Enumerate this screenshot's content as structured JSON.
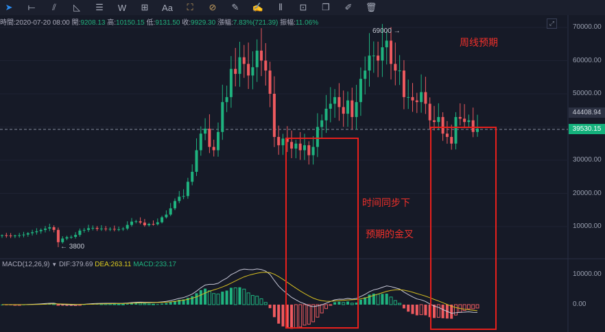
{
  "toolbar": {
    "tools": [
      {
        "name": "cursor-tool",
        "glyph": "➤",
        "cls": "sel"
      },
      {
        "name": "horizontal-line-tool",
        "glyph": "⟝"
      },
      {
        "name": "trend-line-tool",
        "glyph": "⫽"
      },
      {
        "name": "triangle-tool",
        "glyph": "◺"
      },
      {
        "name": "parallel-lines-tool",
        "glyph": "☰"
      },
      {
        "name": "wave-tool",
        "glyph": "W"
      },
      {
        "name": "measure-tool",
        "glyph": "⊞"
      },
      {
        "name": "text-tool",
        "glyph": "Aa"
      },
      {
        "name": "pattern-tool",
        "glyph": "⛶",
        "cls": "gold"
      },
      {
        "name": "hide-drawings-tool",
        "glyph": "⊘",
        "cls": "gold"
      },
      {
        "name": "ruler-tool",
        "glyph": "✎"
      },
      {
        "name": "pen-tool",
        "glyph": "✍"
      },
      {
        "name": "candles-tool",
        "glyph": "⫴"
      },
      {
        "name": "lock-tool",
        "glyph": "⊡"
      },
      {
        "name": "copy-tool",
        "glyph": "❐"
      },
      {
        "name": "edit-tool",
        "glyph": "✐"
      },
      {
        "name": "delete-tool",
        "glyph": "🗑"
      }
    ]
  },
  "info": {
    "time_label": "時間:",
    "time": "2020-07-20 08:00",
    "open_label": "開:",
    "open": "9208.13",
    "high_label": "高:",
    "high": "10150.15",
    "low_label": "低:",
    "low": "9131.50",
    "close_label": "收:",
    "close": "9929.30",
    "change_label": "漲幅:",
    "change": "7.83%(721.39)",
    "amp_label": "振幅:",
    "amp": "11.06%"
  },
  "macd": {
    "title": "MACD(12,26,9)",
    "dif": "DIF:379.69",
    "dea": "DEA:263.11",
    "macd": "MACD:233.17"
  },
  "axis": {
    "price": [
      "70000.00",
      "60000.00",
      "50000.00",
      "40000.00",
      "30000.00",
      "20000.00",
      "10000.00"
    ],
    "price_values": [
      70000,
      60000,
      50000,
      40000,
      30000,
      20000,
      10000
    ],
    "macd": [
      "10000.00",
      "0.00"
    ],
    "macd_values": [
      10000,
      0
    ]
  },
  "tags": {
    "high_price": "44408.94",
    "last_price": "39530.15"
  },
  "markers": {
    "max": "69000",
    "min": "3800"
  },
  "annotations": {
    "weekly": "周线预期",
    "sync": "时间同步下",
    "golden": "预期的金叉"
  },
  "colors": {
    "up": "#1fb37f",
    "down": "#ee5a5f",
    "dif": "#c8c8d8",
    "dea": "#d8c020",
    "box": "#e8201c"
  },
  "chart_data": {
    "type": "candlestick",
    "closes_k": [
      7.4,
      7.3,
      7.2,
      7.3,
      7.4,
      7.6,
      8.0,
      8.3,
      8.6,
      9.0,
      9.4,
      9.8,
      9.0,
      5.3,
      6.4,
      6.8,
      6.9,
      7.5,
      8.8,
      9.0,
      9.5,
      9.6,
      9.3,
      9.4,
      9.2,
      9.3,
      9.1,
      9.2,
      9.4,
      10.5,
      11.5,
      11.6,
      11.2,
      10.4,
      10.8,
      10.7,
      11.3,
      12.8,
      13.6,
      15.5,
      17.7,
      19.0,
      19.2,
      23.5,
      26.5,
      33.0,
      38.0,
      39.5,
      34.0,
      33.0,
      38.5,
      47.5,
      49.0,
      57.5,
      56.0,
      61.0,
      59.0,
      55.5,
      58.0,
      63.0,
      60.0,
      57.0,
      50.0,
      37.0,
      34.5,
      36.5,
      35.5,
      33.5,
      35.0,
      33.0,
      34.5,
      31.5,
      34.0,
      40.0,
      42.0,
      45.5,
      47.0,
      49.0,
      46.0,
      44.0,
      48.0,
      43.0,
      47.5,
      54.5,
      57.0,
      61.5,
      61.5,
      60.0,
      64.0,
      66.0,
      59.0,
      57.0,
      57.0,
      49.0,
      49.0,
      48.0,
      47.5,
      50.5,
      47.0,
      42.0,
      41.5,
      43.0,
      38.0,
      37.0,
      35.0,
      43.0,
      42.5,
      41.5,
      42.0,
      38.5,
      39.5
    ],
    "ylim": [
      0,
      75000
    ]
  }
}
